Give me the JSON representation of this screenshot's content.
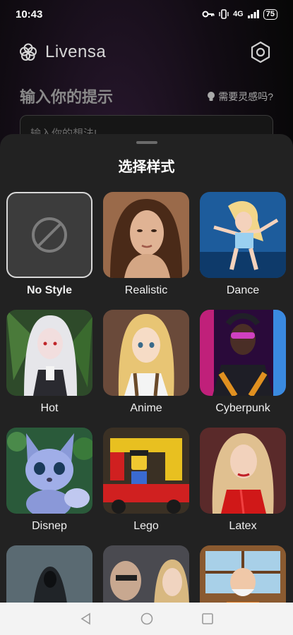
{
  "status": {
    "time": "10:43",
    "network": "4G",
    "battery": "75"
  },
  "app": {
    "name": "Livensa"
  },
  "prompt": {
    "title": "输入你的提示",
    "inspiration": "需要灵感吗?",
    "placeholder": "输入你的想法!"
  },
  "sheet": {
    "title": "选择样式",
    "styles": [
      {
        "label": "No Style",
        "selected": true
      },
      {
        "label": "Realistic"
      },
      {
        "label": "Dance"
      },
      {
        "label": "Hot"
      },
      {
        "label": "Anime"
      },
      {
        "label": "Cyberpunk"
      },
      {
        "label": "Disnep"
      },
      {
        "label": "Lego"
      },
      {
        "label": "Latex"
      },
      {
        "label": ""
      },
      {
        "label": ""
      },
      {
        "label": ""
      }
    ]
  },
  "nav": {
    "back": "back-icon",
    "home": "home-icon",
    "recents": "recents-icon"
  }
}
